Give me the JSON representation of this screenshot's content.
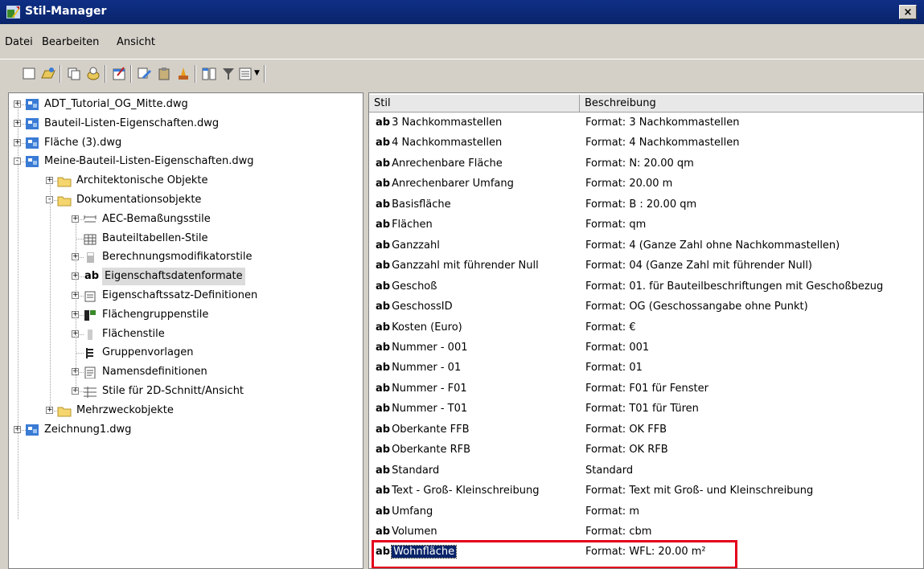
{
  "window": {
    "title": "Stil-Manager",
    "close_label": "×"
  },
  "menu": [
    "Datei",
    "Bearbeiten",
    "Ansicht"
  ],
  "toolbar_icons": [
    "new-icon",
    "open-icon",
    "copy-icon",
    "purge-icon",
    "properties-icon",
    "edit-icon",
    "paste-icon",
    "clean-icon",
    "compare-icon",
    "filter-icon",
    "view-icon"
  ],
  "tree": [
    {
      "label": "ADT_Tutorial_OG_Mitte.dwg"
    },
    {
      "label": "Bauteil-Listen-Eigenschaften.dwg"
    },
    {
      "label": "Fläche (3).dwg"
    },
    {
      "label": "Meine-Bauteil-Listen-Eigenschaften.dwg"
    },
    {
      "label": "Architektonische Objekte"
    },
    {
      "label": "Dokumentationsobjekte"
    },
    {
      "label": "AEC-Bemaßungsstile"
    },
    {
      "label": "Bauteiltabellen-Stile"
    },
    {
      "label": "Berechnungsmodifikatorstile"
    },
    {
      "label": "Eigenschaftsdatenformate",
      "ab": "ab"
    },
    {
      "label": "Eigenschaftssatz-Definitionen"
    },
    {
      "label": "Flächengruppenstile"
    },
    {
      "label": "Flächenstile"
    },
    {
      "label": "Gruppenvorlagen"
    },
    {
      "label": "Namensdefinitionen"
    },
    {
      "label": "Stile für 2D-Schnitt/Ansicht"
    },
    {
      "label": "Mehrzweckobjekte"
    },
    {
      "label": "Zeichnung1.dwg"
    }
  ],
  "list": {
    "headers": {
      "stil": "Stil",
      "beschreibung": "Beschreibung"
    },
    "ab": "ab",
    "rows": [
      {
        "stil": "3 Nachkommastellen",
        "desc": "Format: 3 Nachkommastellen"
      },
      {
        "stil": "4 Nachkommastellen",
        "desc": "Format: 4 Nachkommastellen"
      },
      {
        "stil": "Anrechenbare Fläche",
        "desc": "Format: N: 20.00 qm"
      },
      {
        "stil": "Anrechenbarer Umfang",
        "desc": "Format: 20.00 m"
      },
      {
        "stil": "Basisfläche",
        "desc": "Format: B : 20.00 qm"
      },
      {
        "stil": "Flächen",
        "desc": "Format: qm"
      },
      {
        "stil": "Ganzzahl",
        "desc": "Format: 4 (Ganze Zahl ohne Nachkommastellen)"
      },
      {
        "stil": "Ganzzahl mit führender Null",
        "desc": "Format: 04 (Ganze Zahl mit führender Null)"
      },
      {
        "stil": "Geschoß",
        "desc": "Format: 01. für Bauteilbeschriftungen mit Geschoßbezug"
      },
      {
        "stil": "GeschossID",
        "desc": "Format: OG (Geschossangabe ohne Punkt)"
      },
      {
        "stil": "Kosten (Euro)",
        "desc": "Format: €"
      },
      {
        "stil": "Nummer - 001",
        "desc": "Format: 001"
      },
      {
        "stil": "Nummer - 01",
        "desc": "Format: 01"
      },
      {
        "stil": "Nummer - F01",
        "desc": "Format: F01 für Fenster"
      },
      {
        "stil": "Nummer - T01",
        "desc": "Format: T01 für Türen"
      },
      {
        "stil": "Oberkante FFB",
        "desc": "Format:  OK FFB"
      },
      {
        "stil": "Oberkante RFB",
        "desc": "Format: OK RFB"
      },
      {
        "stil": "Standard",
        "desc": "Standard"
      },
      {
        "stil": "Text - Groß- Kleinschreibung",
        "desc": "Format: Text mit Groß- und Kleinschreibung"
      },
      {
        "stil": "Umfang",
        "desc": "Format: m"
      },
      {
        "stil": "Volumen",
        "desc": "Format: cbm"
      },
      {
        "stil": "Wohnfläche",
        "desc": "Format: WFL: 20.00 m²"
      }
    ]
  },
  "colors": {
    "selection": "#0a246a",
    "highlight_border": "#e3001b",
    "titlebar": "#0a246a"
  }
}
